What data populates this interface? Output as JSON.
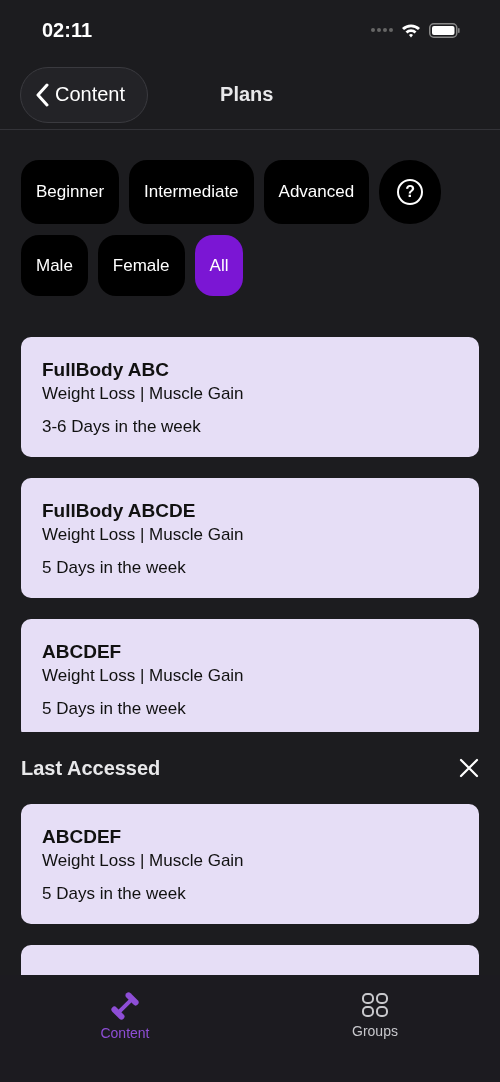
{
  "status_bar": {
    "time": "02:11"
  },
  "nav": {
    "back_label": "Content",
    "title": "Plans"
  },
  "filters": [
    [
      {
        "label": "Beginner",
        "selected": false
      },
      {
        "label": "Intermediate",
        "selected": false
      },
      {
        "label": "Advanced",
        "selected": false
      },
      {
        "kind": "help",
        "label": "?",
        "selected": false
      }
    ],
    [
      {
        "label": "Male",
        "selected": false
      },
      {
        "label": "Female",
        "selected": false
      },
      {
        "label": "All",
        "selected": true
      }
    ]
  ],
  "plans": [
    {
      "title": "FullBody ABC",
      "goals": "Weight Loss | Muscle Gain",
      "days": "3-6 Days in the week"
    },
    {
      "title": "FullBody ABCDE",
      "goals": "Weight Loss | Muscle Gain",
      "days": "5 Days in the week"
    },
    {
      "title": "ABCDEF",
      "goals": "Weight Loss | Muscle Gain",
      "days": "5 Days in the week"
    }
  ],
  "last_accessed": {
    "title": "Last Accessed",
    "plans": [
      {
        "title": "ABCDEF",
        "goals": "Weight Loss | Muscle Gain",
        "days": "5 Days in the week"
      },
      {
        "kind": "partial"
      }
    ]
  },
  "tab_bar": [
    {
      "label": "Content",
      "kind": "dumbbell",
      "selected": true
    },
    {
      "label": "Groups",
      "kind": "grid",
      "selected": false
    }
  ]
}
